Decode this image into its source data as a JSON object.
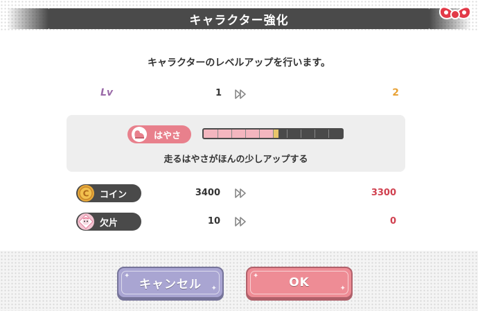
{
  "dialog": {
    "title": "キャラクター強化",
    "message": "キャラクターのレベルアップを行います。"
  },
  "level": {
    "label": "Lv",
    "current": "1",
    "next": "2"
  },
  "skill": {
    "name": "はやさ",
    "description": "走るはやさがほんの少しアップする",
    "bar_filled_fraction": 0.5,
    "bar_new_fraction": 0.04,
    "bar_segments": 10
  },
  "resources": [
    {
      "name": "コイン",
      "icon": "coin-icon",
      "current": "3400",
      "next": "3300"
    },
    {
      "name": "欠片",
      "icon": "character-fragment-icon",
      "current": "10",
      "next": "0"
    }
  ],
  "buttons": {
    "cancel_label": "キャンセル",
    "ok_label": "OK"
  },
  "colors": {
    "title_bar": "#4a4a4a",
    "accent_pink": "#e8808c",
    "next_value_red": "#d0404f",
    "level_next_orange": "#e8a236",
    "cancel_button": "#a9a5d2",
    "ok_button": "#ee8c95"
  }
}
